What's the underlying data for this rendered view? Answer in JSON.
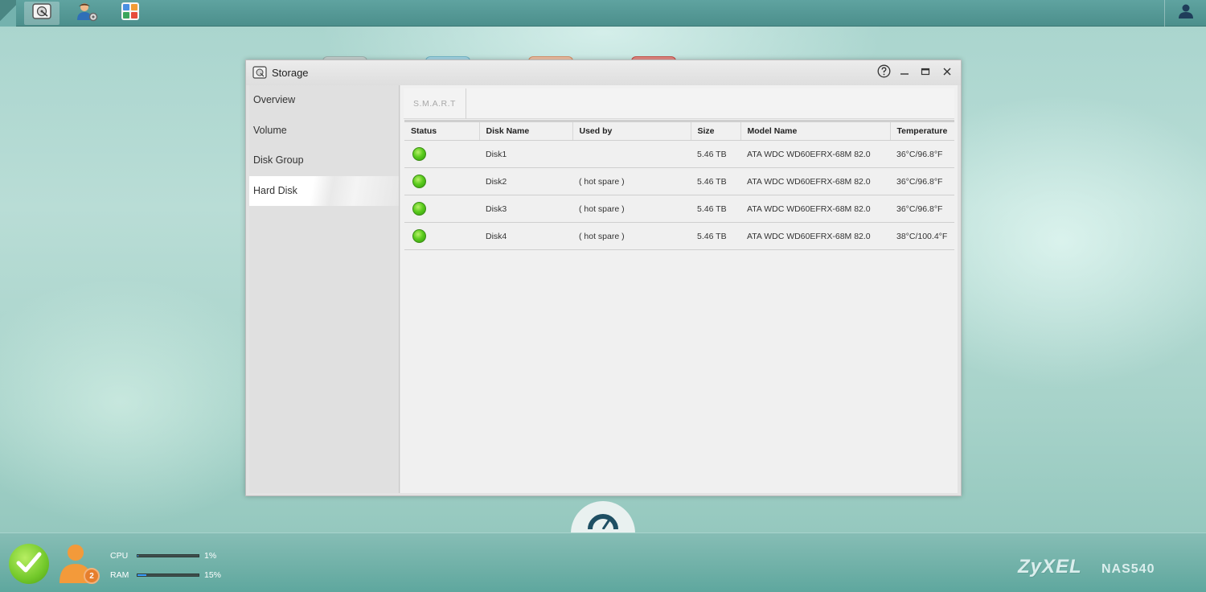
{
  "topbar": {
    "apps": [
      {
        "name": "storage-manager",
        "icon": "hard-disk-icon",
        "active": true
      },
      {
        "name": "control-panel",
        "icon": "user-gear-icon",
        "active": false
      },
      {
        "name": "app-center",
        "icon": "apps-grid-icon",
        "active": false
      }
    ],
    "user_icon": "user-icon"
  },
  "window": {
    "title": "Storage",
    "icon": "hard-disk-icon",
    "controls": [
      "help-icon",
      "minimize-icon",
      "maximize-icon",
      "close-icon"
    ]
  },
  "sidebar": {
    "items": [
      {
        "label": "Overview"
      },
      {
        "label": "Volume"
      },
      {
        "label": "Disk Group"
      },
      {
        "label": "Hard Disk",
        "active": true
      }
    ]
  },
  "toolbar": {
    "smart_label": "S.M.A.R.T"
  },
  "table": {
    "headers": [
      "Status",
      "Disk Name",
      "Used by",
      "Size",
      "Model Name",
      "Temperature"
    ],
    "rows": [
      {
        "status": "ok",
        "disk": "Disk1",
        "used_by": "",
        "size": "5.46 TB",
        "model": "ATA WDC WD60EFRX-68M 82.0",
        "temp": "36°C/96.8°F"
      },
      {
        "status": "ok",
        "disk": "Disk2",
        "used_by": "( hot spare )",
        "size": "5.46 TB",
        "model": "ATA WDC WD60EFRX-68M 82.0",
        "temp": "36°C/96.8°F"
      },
      {
        "status": "ok",
        "disk": "Disk3",
        "used_by": "( hot spare )",
        "size": "5.46 TB",
        "model": "ATA WDC WD60EFRX-68M 82.0",
        "temp": "36°C/96.8°F"
      },
      {
        "status": "ok",
        "disk": "Disk4",
        "used_by": "( hot spare )",
        "size": "5.46 TB",
        "model": "ATA WDC WD60EFRX-68M 82.0",
        "temp": "38°C/100.4°F"
      }
    ],
    "status_color": "#5ccc1e"
  },
  "bottombar": {
    "users_count": "2",
    "cpu": {
      "label": "CPU",
      "value": "1%",
      "fraction": 0.01
    },
    "ram": {
      "label": "RAM",
      "value": "15%",
      "fraction": 0.15
    },
    "brand": "ZyXEL",
    "model": "NAS540",
    "meter_color": "#3aa0ff"
  }
}
